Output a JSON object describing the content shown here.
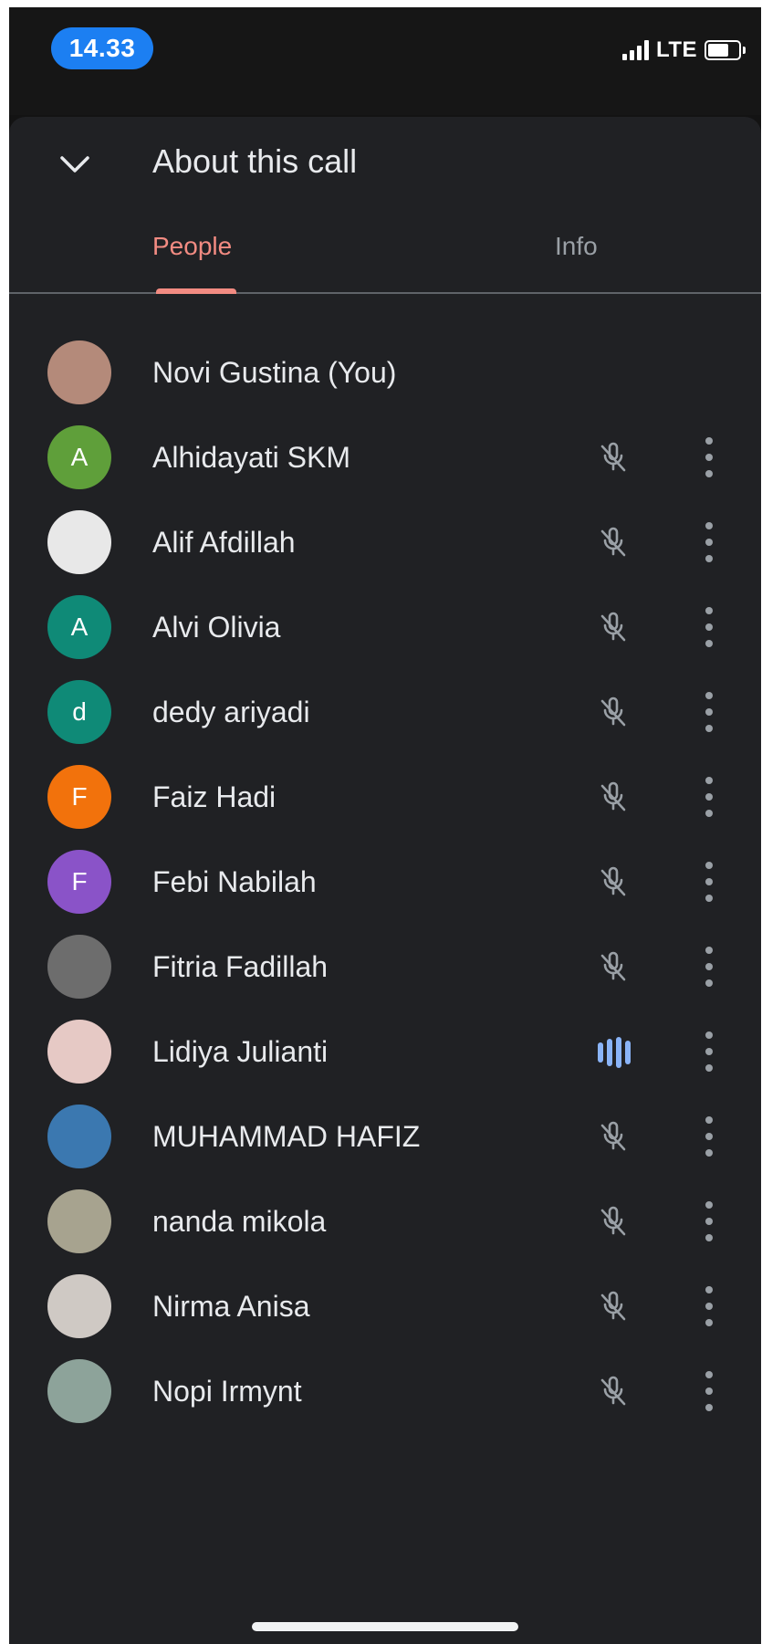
{
  "status_bar": {
    "time": "14.33",
    "network": "LTE"
  },
  "header": {
    "title": "About this call"
  },
  "tabs": [
    {
      "label": "People",
      "active": true
    },
    {
      "label": "Info",
      "active": false
    }
  ],
  "colors": {
    "accent": "#f28b82",
    "speaking": "#8ab4f8",
    "background": "#202124"
  },
  "participants": [
    {
      "name": "Novi Gustina (You)",
      "avatar_letter": "",
      "avatar_color": "#b48a7a",
      "status": "none"
    },
    {
      "name": "Alhidayati SKM",
      "avatar_letter": "A",
      "avatar_color": "#5f9f3a",
      "status": "muted"
    },
    {
      "name": "Alif Afdillah",
      "avatar_letter": "",
      "avatar_color": "#e8e8e8",
      "status": "muted"
    },
    {
      "name": "Alvi Olivia",
      "avatar_letter": "A",
      "avatar_color": "#0f8a77",
      "status": "muted"
    },
    {
      "name": "dedy ariyadi",
      "avatar_letter": "d",
      "avatar_color": "#0f8a77",
      "status": "muted"
    },
    {
      "name": "Faiz Hadi",
      "avatar_letter": "F",
      "avatar_color": "#f2720c",
      "status": "muted"
    },
    {
      "name": "Febi Nabilah",
      "avatar_letter": "F",
      "avatar_color": "#8a53c8",
      "status": "muted"
    },
    {
      "name": "Fitria Fadillah",
      "avatar_letter": "",
      "avatar_color": "#6d6d6d",
      "status": "muted"
    },
    {
      "name": "Lidiya Julianti",
      "avatar_letter": "",
      "avatar_color": "#e6c9c5",
      "status": "speaking"
    },
    {
      "name": "MUHAMMAD HAFIZ",
      "avatar_letter": "",
      "avatar_color": "#3b78b0",
      "status": "muted"
    },
    {
      "name": "nanda mikola",
      "avatar_letter": "",
      "avatar_color": "#a7a38f",
      "status": "muted"
    },
    {
      "name": "Nirma Anisa",
      "avatar_letter": "",
      "avatar_color": "#cfc9c4",
      "status": "muted"
    },
    {
      "name": "Nopi Irmynt",
      "avatar_letter": "",
      "avatar_color": "#8da39a",
      "status": "muted"
    }
  ]
}
